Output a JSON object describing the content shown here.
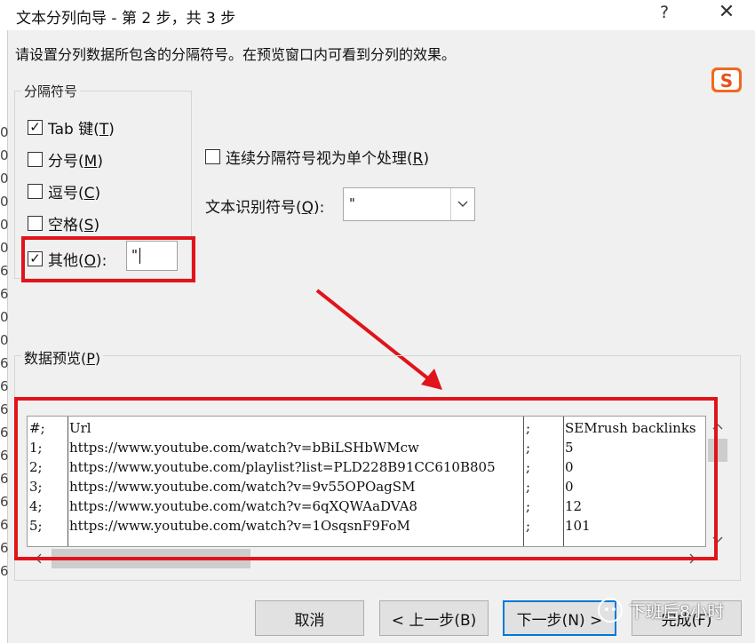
{
  "window": {
    "title": "文本分列向导 - 第 2 步，共 3 步",
    "help_icon": "?",
    "close_icon": "✕"
  },
  "instruction": "请设置分列数据所包含的分隔符号。在预览窗口内可看到分列的效果。",
  "delimiters": {
    "legend": "分隔符号",
    "tab": {
      "label": "Tab 键(",
      "key": "T",
      "suffix": ")",
      "checked": true
    },
    "semicolon": {
      "label": "分号(",
      "key": "M",
      "suffix": ")",
      "checked": false
    },
    "comma": {
      "label": "逗号(",
      "key": "C",
      "suffix": ")",
      "checked": false
    },
    "space": {
      "label": "空格(",
      "key": "S",
      "suffix": ")",
      "checked": false
    },
    "other": {
      "label": "其他(",
      "key": "O",
      "suffix": "):",
      "checked": true,
      "value": "\""
    }
  },
  "consecutive": {
    "label": "连续分隔符号视为单个处理(",
    "key": "R",
    "suffix": ")",
    "checked": false
  },
  "qualifier": {
    "label": "文本识别符号(",
    "key": "Q",
    "suffix": "):",
    "value": "\""
  },
  "preview": {
    "legend_prefix": "数据预览(",
    "legend_key": "P",
    "legend_suffix": ")",
    "rows": [
      {
        "c1": "#;",
        "c2": "Url",
        "c3": ";",
        "c4": "SEMrush backlinks"
      },
      {
        "c1": "1;",
        "c2": "https://www.youtube.com/watch?v=bBiLSHbWMcw",
        "c3": ";",
        "c4": "5"
      },
      {
        "c1": "2;",
        "c2": "https://www.youtube.com/playlist?list=PLD228B91CC610B805",
        "c3": ";",
        "c4": "0"
      },
      {
        "c1": "3;",
        "c2": "https://www.youtube.com/watch?v=9v55OPOagSM",
        "c3": ";",
        "c4": "0"
      },
      {
        "c1": "4;",
        "c2": "https://www.youtube.com/watch?v=6qXQWAaDVA8",
        "c3": ";",
        "c4": "12"
      },
      {
        "c1": "5;",
        "c2": "https://www.youtube.com/watch?v=1OsqsnF9FoM",
        "c3": ";",
        "c4": "101"
      }
    ]
  },
  "buttons": {
    "cancel": "取消",
    "back": "< 上一步(B)",
    "next": "下一步(N) >",
    "finish": "完成(F)"
  },
  "watermark": "下班后8小时",
  "ime_logo": "S",
  "spreadsheet_edge": [
    "0",
    "0",
    "0",
    "0",
    "0",
    "0",
    "6",
    "6",
    "0",
    "0",
    "6",
    "6",
    "6",
    "6",
    "6",
    "6",
    "6",
    "6",
    "6",
    "6"
  ],
  "colors": {
    "highlight_red": "#e0141a",
    "default_button_border": "#0078d7"
  }
}
